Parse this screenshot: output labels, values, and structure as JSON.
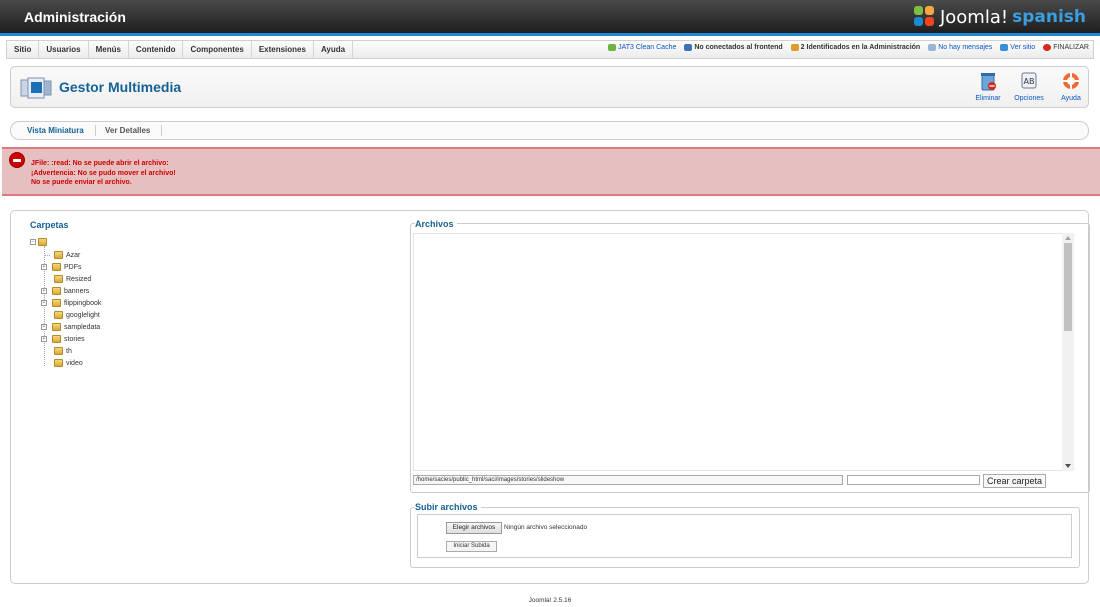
{
  "header": {
    "title": "Administración",
    "logo_text": "Joomla!",
    "logo_sub": "spanish"
  },
  "menu": [
    "Sitio",
    "Usuarios",
    "Menús",
    "Contenido",
    "Componentes",
    "Extensiones",
    "Ayuda"
  ],
  "status": {
    "cache": "JAT3 Clean Cache",
    "frontend": "No conectados al frontend",
    "admins": "2 Identificados en la Administración",
    "messages": "No hay mensajes",
    "view_site": "Ver sitio",
    "logout": "FINALIZAR"
  },
  "toolbar": {
    "title": "Gestor Multimedia",
    "delete": "Eliminar",
    "options": "Opciones",
    "help": "Ayuda"
  },
  "submenu": {
    "thumbs": "Vista Miniatura",
    "details": "Ver Detalles"
  },
  "errors": [
    "JFile: :read: No se puede abrir el archivo:",
    "¡Advertencia: No se pudo mover el archivo!",
    "No se puede enviar el archivo."
  ],
  "folders": {
    "title": "Carpetas",
    "items": [
      "Azar",
      "PDFs",
      "Resized",
      "banners",
      "flippingbook",
      "googlelight",
      "sampledata",
      "stories",
      "th",
      "video"
    ]
  },
  "files": {
    "title": "Archivos",
    "path": "/home/sacies/public_html/saci/images/stories/slideshow",
    "new_folder_value": "",
    "create_folder": "Crear carpeta"
  },
  "upload": {
    "title": "Subir archivos",
    "choose": "Elegir archivos",
    "no_file": "Ningún archivo seleccionado",
    "start": "Iniciar Subida"
  },
  "footer": "Joomla! 2.5.16",
  "colors": {
    "accent": "#1c8ad2",
    "title_blue": "#146295",
    "error_red": "#cc0000",
    "error_bg": "#e6c0c0"
  }
}
